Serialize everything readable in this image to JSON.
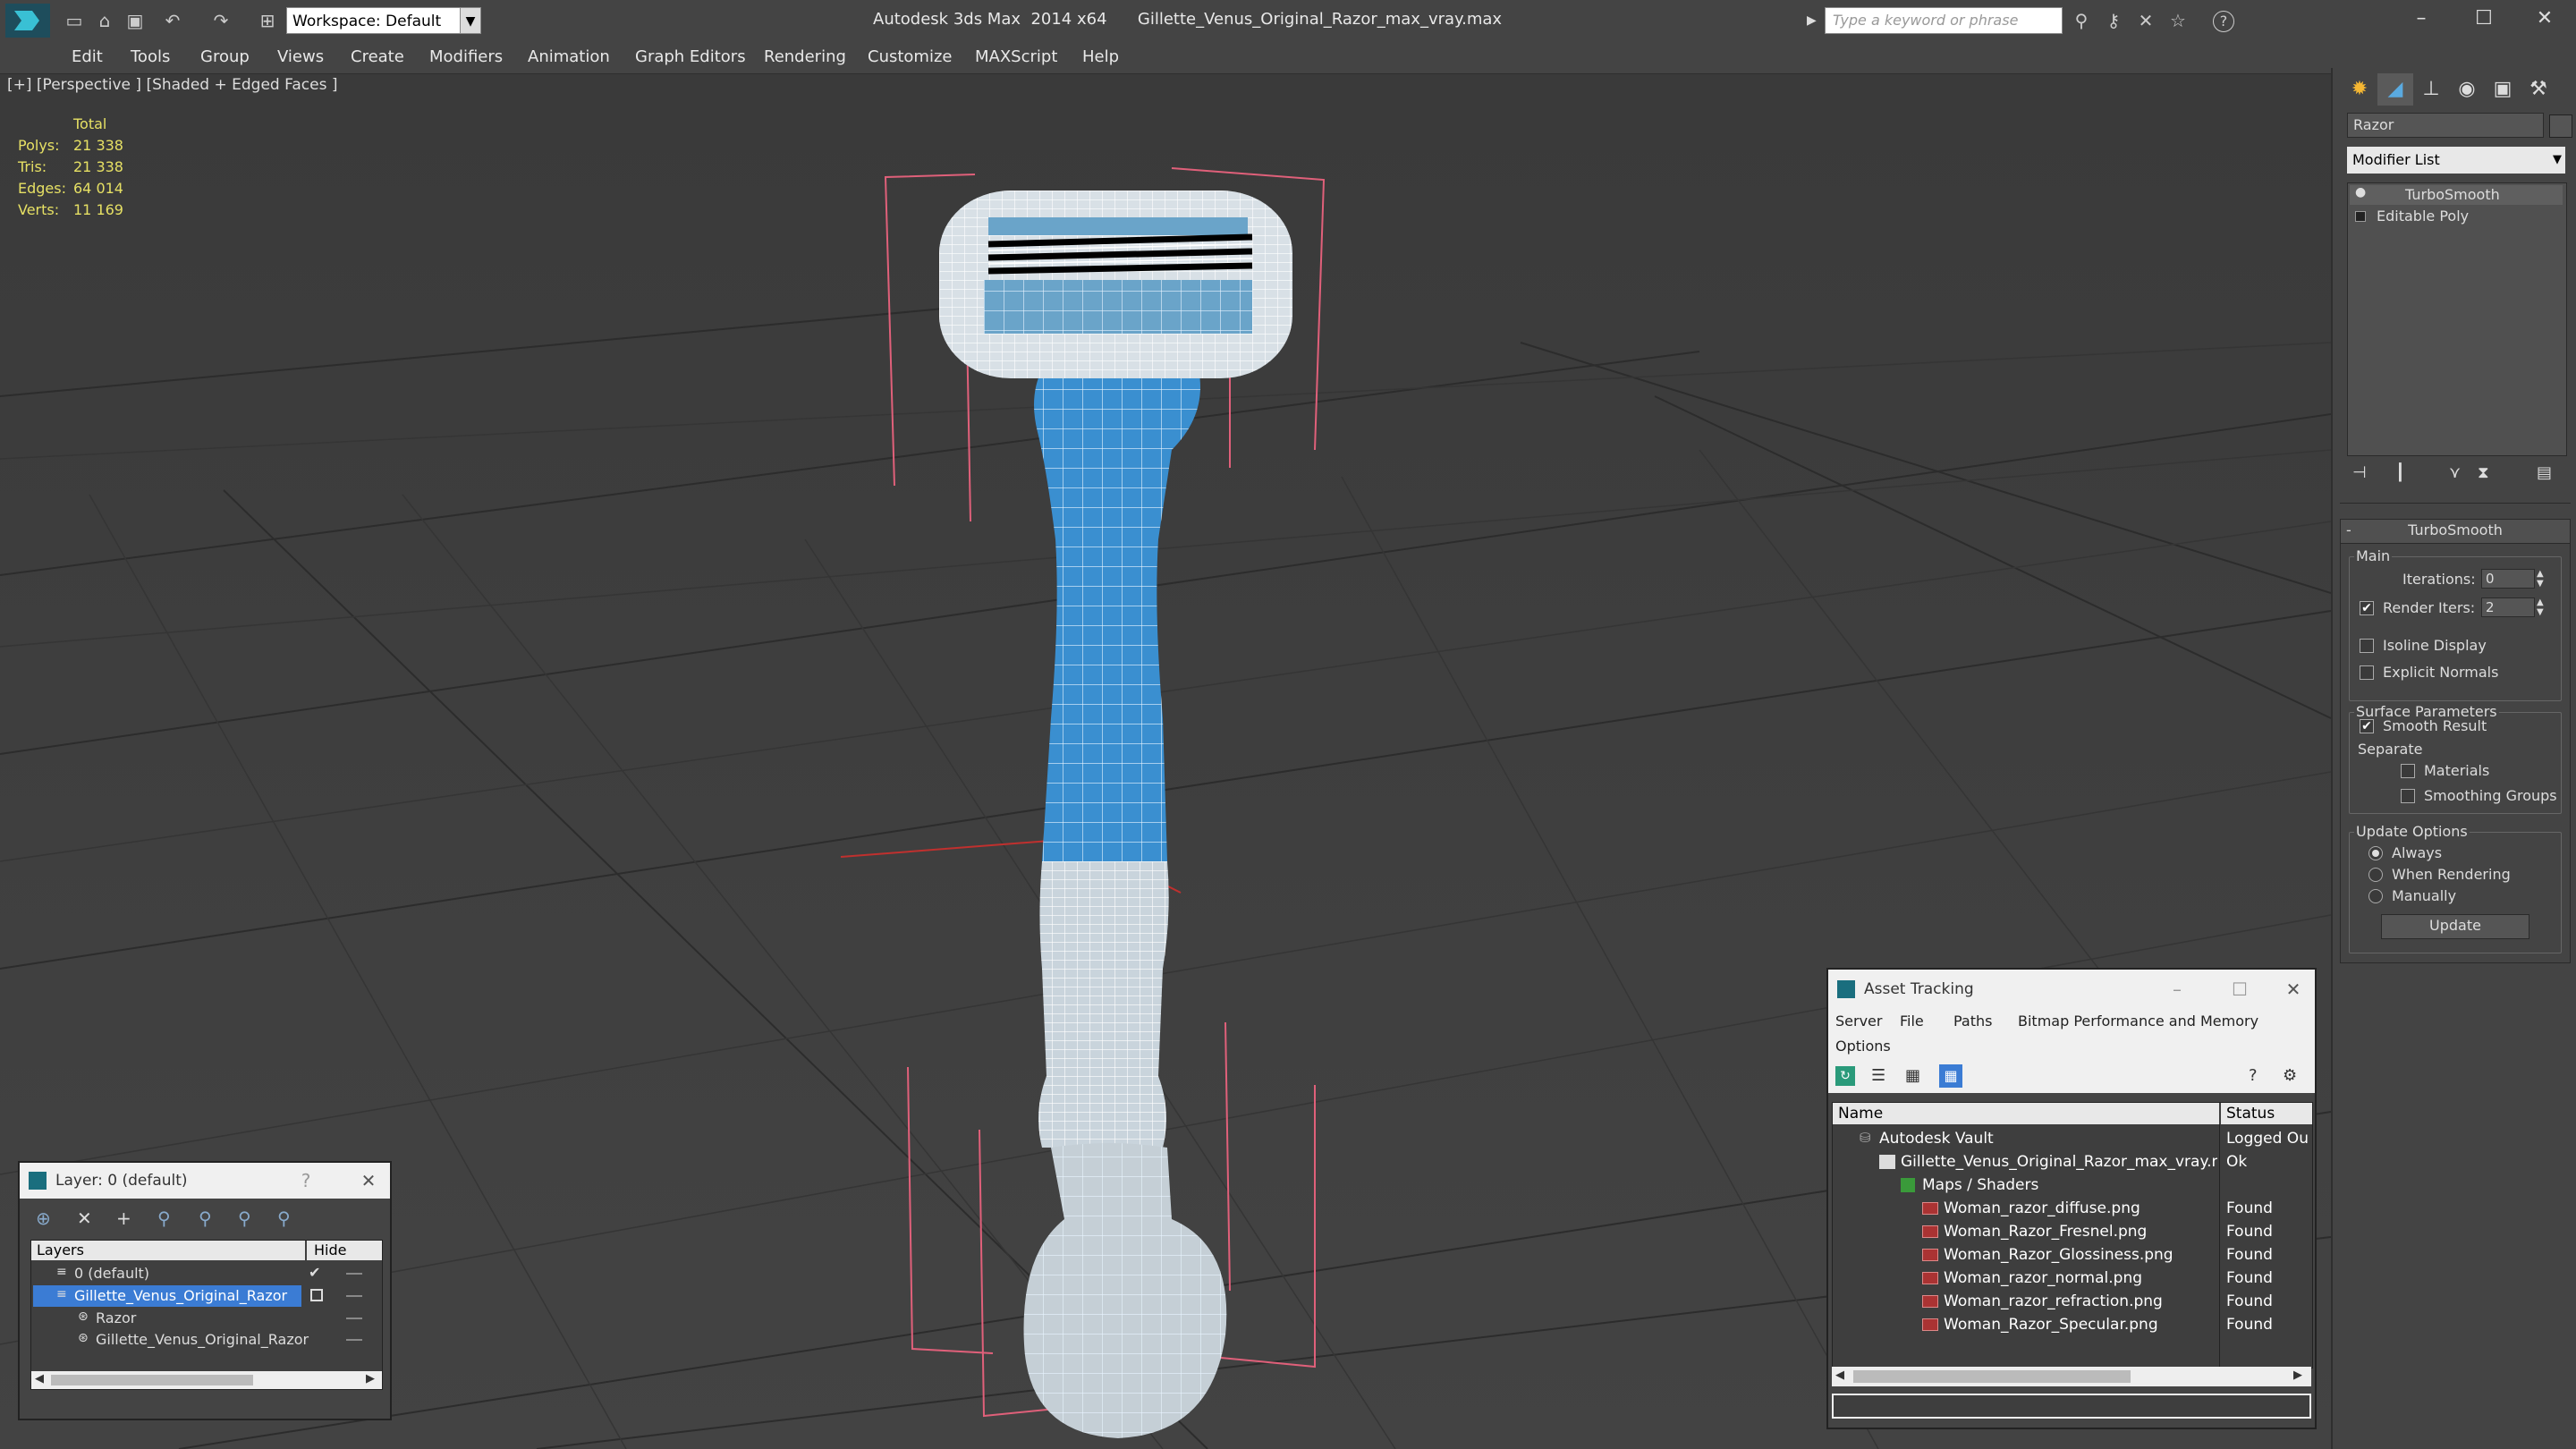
{
  "titlebar": {
    "app_title": "Autodesk 3ds Max  2014 x64",
    "file_name": "Gillette_Venus_Original_Razor_max_vray.max",
    "workspace_label": "Workspace: Default",
    "search_placeholder": "Type a keyword or phrase",
    "help_label": "?"
  },
  "menu": [
    "Edit",
    "Tools",
    "Group",
    "Views",
    "Create",
    "Modifiers",
    "Animation",
    "Graph Editors",
    "Rendering",
    "Customize",
    "MAXScript",
    "Help"
  ],
  "viewport": {
    "label": "[+] [Perspective ] [Shaded + Edged Faces ]",
    "stats": {
      "header": "Total",
      "rows": [
        {
          "label": "Polys:",
          "value": "21 338"
        },
        {
          "label": "Tris:",
          "value": "21 338"
        },
        {
          "label": "Edges:",
          "value": "64 014"
        },
        {
          "label": "Verts:",
          "value": "11 169"
        }
      ]
    }
  },
  "command_panel": {
    "object_name": "Razor",
    "modifier_list_label": "Modifier List",
    "stack": [
      "TurboSmooth",
      "Editable Poly"
    ],
    "rollout_title": "TurboSmooth",
    "main_label": "Main",
    "iterations_label": "Iterations:",
    "iterations_value": "0",
    "render_iters_label": "Render Iters:",
    "render_iters_value": "2",
    "isoline_label": "Isoline Display",
    "explicit_normals_label": "Explicit Normals",
    "surface_params_label": "Surface Parameters",
    "smooth_result_label": "Smooth Result",
    "separate_label": "Separate",
    "materials_label": "Materials",
    "smoothing_groups_label": "Smoothing Groups",
    "update_options_label": "Update Options",
    "always_label": "Always",
    "when_rendering_label": "When Rendering",
    "manually_label": "Manually",
    "update_button": "Update"
  },
  "layer_window": {
    "title": "Layer: 0 (default)",
    "help": "?",
    "col_layers": "Layers",
    "col_hide": "Hide",
    "rows": [
      "0 (default)",
      "Gillette_Venus_Original_Razor",
      "Razor",
      "Gillette_Venus_Original_Razor"
    ]
  },
  "asset_window": {
    "title": "Asset Tracking",
    "menu": [
      "Server",
      "File",
      "Paths",
      "Bitmap Performance and Memory",
      "Options"
    ],
    "col_name": "Name",
    "col_status": "Status",
    "rows": [
      {
        "name": "Autodesk Vault",
        "status": "Logged Ou"
      },
      {
        "name": "Gillette_Venus_Original_Razor_max_vray.max",
        "status": "Ok"
      },
      {
        "name": "Maps / Shaders",
        "status": ""
      },
      {
        "name": "Woman_razor_diffuse.png",
        "status": "Found"
      },
      {
        "name": "Woman_Razor_Fresnel.png",
        "status": "Found"
      },
      {
        "name": "Woman_Razor_Glossiness.png",
        "status": "Found"
      },
      {
        "name": "Woman_razor_normal.png",
        "status": "Found"
      },
      {
        "name": "Woman_razor_refraction.png",
        "status": "Found"
      },
      {
        "name": "Woman_Razor_Specular.png",
        "status": "Found"
      }
    ]
  },
  "colors": {
    "accent_blue": "#2a7fd6",
    "razor_blue": "#3a8fd0",
    "selection_blue": "#3b7cd4",
    "stats_yellow": "#e6e064",
    "bbox_pink": "#e0607a"
  }
}
